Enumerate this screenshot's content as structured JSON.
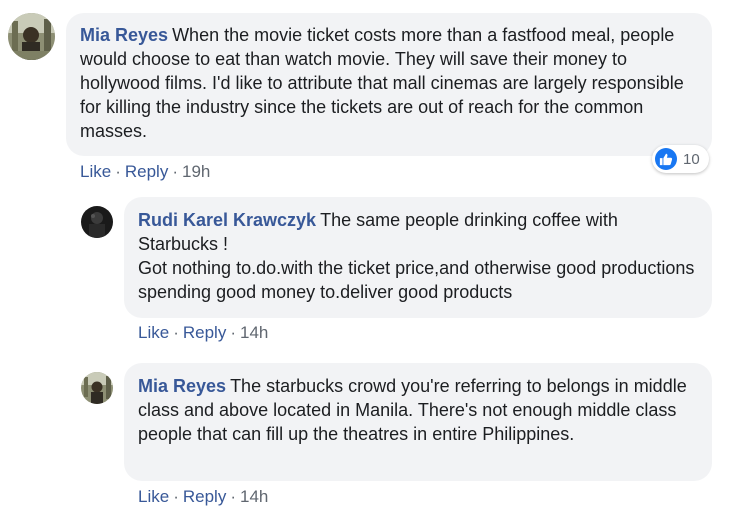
{
  "comments": [
    {
      "author": "Mia Reyes",
      "text": "When the movie ticket costs more than a fastfood meal, people would choose to eat than watch movie. They will save their money to hollywood films. I'd like to attribute that mall cinemas are largely responsible for killing the industry since the tickets are out of reach for the common masses.",
      "like_label": "Like",
      "reply_label": "Reply",
      "time": "19h",
      "reaction_count": "10",
      "reaction_icon": "thumbs-up-icon"
    },
    {
      "author": "Rudi Karel Krawczyk",
      "text": "The same people drinking coffee with Starbucks !\nGot nothing to.do.with the ticket price,and otherwise good productions spending good money to.deliver good products",
      "like_label": "Like",
      "reply_label": "Reply",
      "time": "14h"
    },
    {
      "author": "Mia Reyes",
      "text": "The starbucks crowd you're referring to belongs in middle class and above located in Manila. There's not enough middle class people that can fill up the theatres in entire Philippines.",
      "like_label": "Like",
      "reply_label": "Reply",
      "time": "14h"
    }
  ],
  "colors": {
    "author": "#385898",
    "bubble": "#f2f3f5",
    "meta": "#606770",
    "like_blue": "#1877f2"
  }
}
